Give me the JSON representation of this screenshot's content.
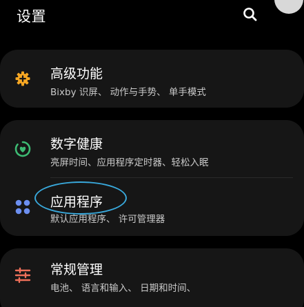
{
  "header": {
    "title": "设置",
    "search_icon": "search-icon"
  },
  "groups": [
    {
      "items": [
        {
          "label": "高级功能",
          "subtitle": "Bixby 识屏、 动作与手势、 单手模式",
          "icon": "advanced-features-icon",
          "icon_color": "#f5a623"
        }
      ]
    },
    {
      "items": [
        {
          "label": "数字健康",
          "subtitle": "亮屏时间、应用程序定时器、轻松入眠",
          "icon": "digital-wellbeing-icon",
          "icon_color": "#3dbb73"
        },
        {
          "label": "应用程序",
          "subtitle": "默认应用程序、 许可管理器",
          "icon": "apps-icon",
          "icon_color": "#6c8ff0"
        }
      ]
    },
    {
      "items": [
        {
          "label": "常规管理",
          "subtitle": "电池、 语言和输入、 日期和时间、",
          "icon": "general-management-icon",
          "icon_color": "#f0705a"
        }
      ]
    }
  ],
  "annotation": {
    "highlighted_item": "应用程序",
    "highlight_color": "#39a9dc"
  }
}
